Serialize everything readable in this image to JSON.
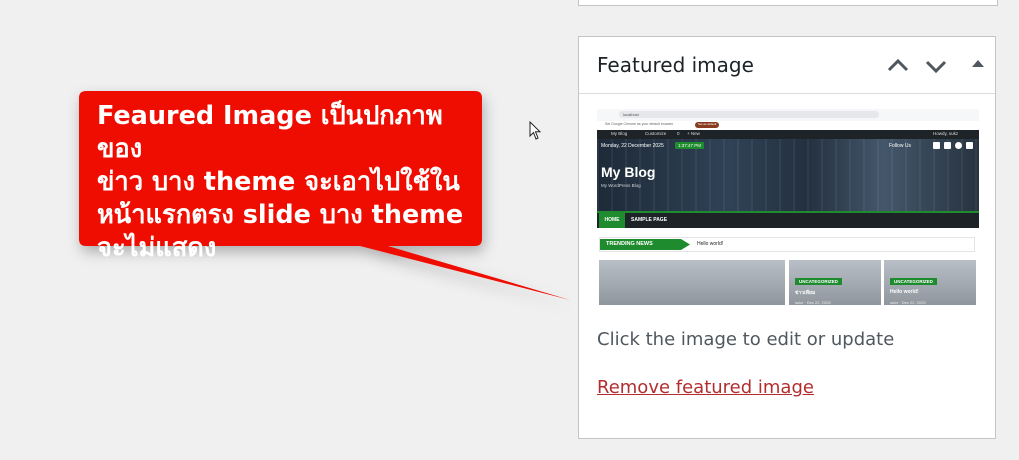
{
  "panel": {
    "title": "Featured image",
    "help_text": "Click the image to edit or update",
    "remove_link": "Remove featured image"
  },
  "callout": {
    "lines": [
      "Feaured Image เป็นปกภาพของ",
      "ข่าว บาง theme จะเอาไปใช้ใน",
      "หน้าแรกตรง slide บาง theme",
      "จะไม่แสดง"
    ],
    "color": "#ee1100"
  },
  "thumbnail": {
    "url": "localhost",
    "notice": "Set Google Chrome as your default browser",
    "notice_button": "Set as default",
    "admin_bar": {
      "site": "My Blog",
      "customize": "Customize",
      "comments": "0",
      "new": "+ New",
      "howdy": "Howdy, sukz"
    },
    "date": "Monday, 22 December 2025",
    "time": "1:37:47 PM",
    "follow": "Follow Us",
    "blog_title": "My Blog",
    "blog_subtitle": "My WordPress Blog",
    "menu": [
      "HOME",
      "SAMPLE PAGE"
    ],
    "trending_label": "TRENDING NEWS",
    "trending_text": "Hello world!",
    "cards": [
      {
        "category": "UNCATEGORIZED",
        "title": "ข่าวเทียม",
        "meta": "sukz · Dec 22, 2025"
      },
      {
        "category": "UNCATEGORIZED",
        "title": "Hello world!",
        "meta": "sukz · Dec 22, 2025"
      }
    ]
  },
  "colors": {
    "accent_green": "#1e8c2e",
    "link_red": "#b32d2e",
    "callout_red": "#ee1100"
  }
}
